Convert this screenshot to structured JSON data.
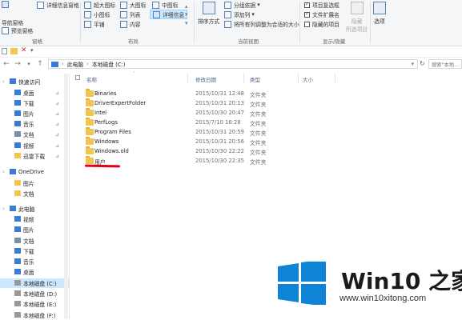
{
  "ribbon": {
    "nav_pane": "导航窗格",
    "preview_pane": "预览窗格",
    "details_pane": "详细信息窗格",
    "pane_group": "窗格",
    "layout": {
      "extra_large": "超大图标",
      "large": "大图标",
      "medium": "中图标",
      "small": "小图标",
      "list": "列表",
      "details": "详细信息",
      "tiles": "平铺",
      "content": "内容"
    },
    "layout_group": "布局",
    "sort_by": "排序方式",
    "group_by": "分组依据",
    "add_column": "添加列",
    "fit_columns": "将所有列调整为合适的大小",
    "current_view_group": "当前视图",
    "checkbox_items": "项目复选框",
    "file_extensions": "文件扩展名",
    "hidden_items": "隐藏的项目",
    "hide_selected": "隐藏",
    "hide_selected_2": "所选项目",
    "options": "选项",
    "show_hide_group": "显示/隐藏"
  },
  "qat": {
    "dropdown": "▾"
  },
  "address": {
    "crumbs": [
      "此电脑",
      "本地磁盘 (C:)"
    ],
    "search_placeholder": "搜索\"本地..."
  },
  "sidebar": {
    "items": [
      {
        "label": "快速访问",
        "icon": "star-icon",
        "pinned": false
      },
      {
        "label": "桌面",
        "icon": "desktop-icon",
        "pinned": true
      },
      {
        "label": "下载",
        "icon": "download-icon",
        "pinned": true
      },
      {
        "label": "图片",
        "icon": "pictures-icon",
        "pinned": true
      },
      {
        "label": "音乐",
        "icon": "music-icon",
        "pinned": true
      },
      {
        "label": "文档",
        "icon": "document-icon",
        "pinned": true
      },
      {
        "label": "视频",
        "icon": "video-icon",
        "pinned": true
      },
      {
        "label": "迅雷下载",
        "icon": "folder-icon",
        "pinned": true
      },
      {
        "label": "OneDrive",
        "icon": "cloud-icon",
        "pinned": false
      },
      {
        "label": "图片",
        "icon": "folder-icon",
        "pinned": false
      },
      {
        "label": "文档",
        "icon": "folder-icon",
        "pinned": false
      },
      {
        "label": "此电脑",
        "icon": "computer-icon",
        "pinned": false
      },
      {
        "label": "视频",
        "icon": "video-icon",
        "pinned": false
      },
      {
        "label": "图片",
        "icon": "pictures-icon",
        "pinned": false
      },
      {
        "label": "文档",
        "icon": "document-icon",
        "pinned": false
      },
      {
        "label": "下载",
        "icon": "download-icon",
        "pinned": false
      },
      {
        "label": "音乐",
        "icon": "music-icon",
        "pinned": false
      },
      {
        "label": "桌面",
        "icon": "desktop-icon",
        "pinned": false
      },
      {
        "label": "本地磁盘 (C:)",
        "icon": "drive-icon",
        "pinned": false
      },
      {
        "label": "本地磁盘 (D:)",
        "icon": "drive-icon",
        "pinned": false
      },
      {
        "label": "本地磁盘 (E:)",
        "icon": "drive-icon",
        "pinned": false
      },
      {
        "label": "本地磁盘 (F:)",
        "icon": "drive-icon",
        "pinned": false
      }
    ]
  },
  "columns": {
    "name": "名称",
    "modified": "修改日期",
    "type": "类型",
    "size": "大小"
  },
  "files": [
    {
      "name": "Binaries",
      "modified": "2015/10/31 12:48",
      "type": "文件夹"
    },
    {
      "name": "DriverExpertFolder",
      "modified": "2015/10/31 20:13",
      "type": "文件夹"
    },
    {
      "name": "Intel",
      "modified": "2015/10/30 20:47",
      "type": "文件夹"
    },
    {
      "name": "PerfLogs",
      "modified": "2015/7/10 16:28",
      "type": "文件夹"
    },
    {
      "name": "Program Files",
      "modified": "2015/10/31 20:59",
      "type": "文件夹"
    },
    {
      "name": "Windows",
      "modified": "2015/10/31 20:56",
      "type": "文件夹"
    },
    {
      "name": "Windows.old",
      "modified": "2015/10/30 22:22",
      "type": "文件夹"
    },
    {
      "name": "用户",
      "modified": "2015/10/30 22:35",
      "type": "文件夹"
    }
  ],
  "watermark": {
    "title": "Win10 之家",
    "url": "www.win10xitong.com"
  },
  "colors": {
    "accent": "#0078d7",
    "selection": "#cce8ff",
    "folder": "#f3c44e",
    "underline": "#e2001a"
  }
}
